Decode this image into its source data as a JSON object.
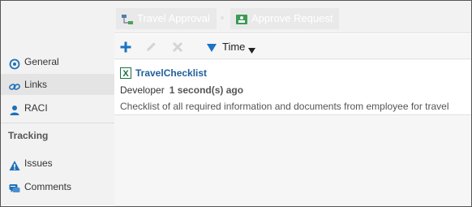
{
  "breadcrumbs": [
    {
      "label": "Travel Approval",
      "icon": "workflow-icon"
    },
    {
      "label": "Approve Request",
      "icon": "task-icon"
    }
  ],
  "sidebar": {
    "items": [
      {
        "label": "General",
        "icon": "general-icon",
        "active": false
      },
      {
        "label": "Links",
        "icon": "link-icon",
        "active": true
      },
      {
        "label": "RACI",
        "icon": "person-icon",
        "active": false
      }
    ],
    "section_title": "Tracking",
    "tracking_items": [
      {
        "label": "Issues",
        "icon": "warning-icon"
      },
      {
        "label": "Comments",
        "icon": "comments-icon"
      }
    ]
  },
  "toolbar": {
    "add": "plus-icon",
    "edit": "pencil-icon",
    "delete": "close-icon",
    "sort_label": "Time"
  },
  "links": [
    {
      "title": "TravelChecklist",
      "author": "Developer",
      "time": "1 second(s) ago",
      "description": "Checklist of all required information and documents from employee for travel",
      "icon": "excel-file-icon"
    }
  ],
  "colors": {
    "accent": "#1f5f99",
    "add_blue": "#1a73c7",
    "warning_blue": "#1f6fb8",
    "excel_green": "#1d6f42"
  }
}
